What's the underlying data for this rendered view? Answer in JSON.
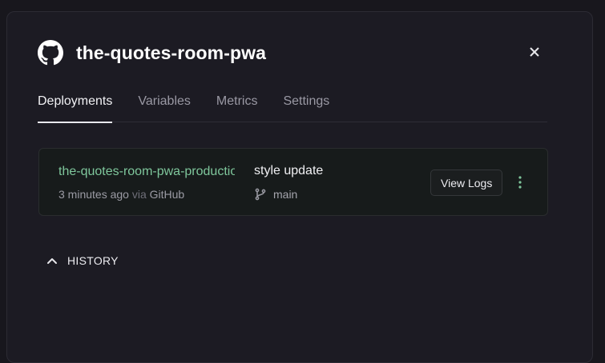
{
  "project": {
    "title": "the-quotes-room-pwa",
    "icon": "github-icon"
  },
  "tabs": [
    {
      "label": "Deployments",
      "active": true
    },
    {
      "label": "Variables",
      "active": false
    },
    {
      "label": "Metrics",
      "active": false
    },
    {
      "label": "Settings",
      "active": false
    }
  ],
  "deployment": {
    "name": "the-quotes-room-pwa-production",
    "time": "3 minutes ago",
    "via": "via",
    "source": "GitHub",
    "commit_message": "style update",
    "branch": "main",
    "view_logs_label": "View Logs"
  },
  "history": {
    "label": "HISTORY"
  },
  "colors": {
    "accent_green": "#7fc79c",
    "background": "#1c1b23"
  }
}
